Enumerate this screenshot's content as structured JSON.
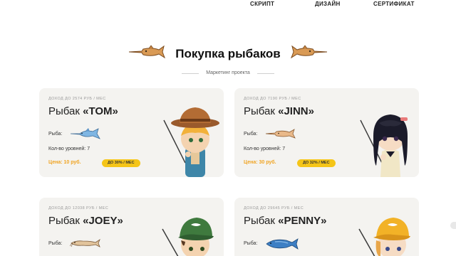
{
  "nav": {
    "script": "СКРИПТ",
    "design": "ДИЗАЙН",
    "certificate": "СЕРТИФИКАТ"
  },
  "heading": {
    "title": "Покупка рыбаков",
    "subtitle": "Маркетинг проекта"
  },
  "labels": {
    "fish": "Рыба:",
    "levels": "Кол-во уровней: 7"
  },
  "cards": [
    {
      "income": "ДОХОД ДО 2574 РУБ / МЕС",
      "prefix": "Рыбак ",
      "name": "«TOM»",
      "price": "Цена: 10 руб.",
      "badge": "ДО 30% / МЕС",
      "fish_icon": "swordfish-icon",
      "hero_icon": "cowboy-fisherman-icon"
    },
    {
      "income": "ДОХОД ДО 7190 РУБ / МЕС",
      "prefix": "Рыбак ",
      "name": "«JINN»",
      "price": "Цена: 30 руб.",
      "badge": "ДО 32% / МЕС",
      "fish_icon": "sawfish-icon",
      "hero_icon": "girl-fisher-icon"
    },
    {
      "income": "ДОХОД ДО 12038 РУБ / МЕС",
      "prefix": "Рыбак ",
      "name": "«JOEY»",
      "fish_icon": "catfish-icon",
      "hero_icon": "cap-fisherman-icon"
    },
    {
      "income": "ДОХОД ДО 29645 РУБ / МЕС",
      "prefix": "Рыбак ",
      "name": "«PENNY»",
      "fish_icon": "blue-fish-icon",
      "hero_icon": "yellow-cap-fisher-icon"
    }
  ],
  "colors": {
    "accent": "#f0a422",
    "badge": "#f5c518",
    "card_bg": "#f4f3f0"
  }
}
